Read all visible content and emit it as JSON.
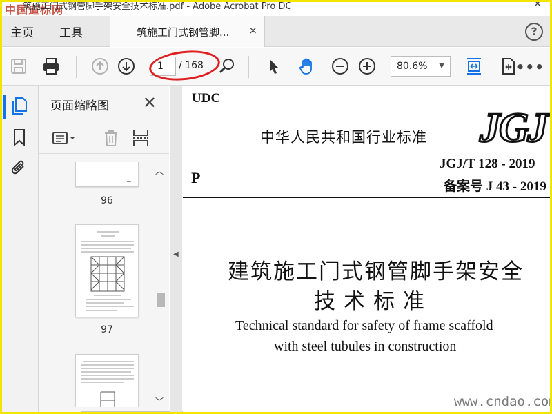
{
  "window": {
    "title": "筑施工门式钢管脚手架安全技术标准.pdf - Adobe Acrobat Pro DC",
    "watermark": "中国道标网"
  },
  "menu": {
    "home": "主页",
    "tools": "工具"
  },
  "tab": {
    "label": "筑施工门式钢管脚...",
    "close": "×"
  },
  "help": "?",
  "toolbar": {
    "page_current": "1",
    "page_total": "/ 168",
    "zoom": "80.6%",
    "more": "•••"
  },
  "thumbnails": {
    "title": "页面缩略图",
    "close": "✕",
    "pages": [
      {
        "number": "96"
      },
      {
        "number": "97"
      }
    ]
  },
  "document": {
    "udc": "UDC",
    "industry": "中华人民共和国行业标准",
    "logo": "JGJ",
    "category": "P",
    "code": "JGJ/T 128 - 2019",
    "record": "备案号 J 43 - 2019",
    "title_cn_1": "建筑施工门式钢管脚手架安全",
    "title_cn_2": "技术标准",
    "title_en_1": "Technical standard for safety of frame scaffold",
    "title_en_2": "with steel tubules in construction"
  },
  "watermark_bottom": "www.cndao.com",
  "colors": {
    "accent": "#1473e6",
    "annotation": "#e02020",
    "frame": "#f2e600"
  }
}
